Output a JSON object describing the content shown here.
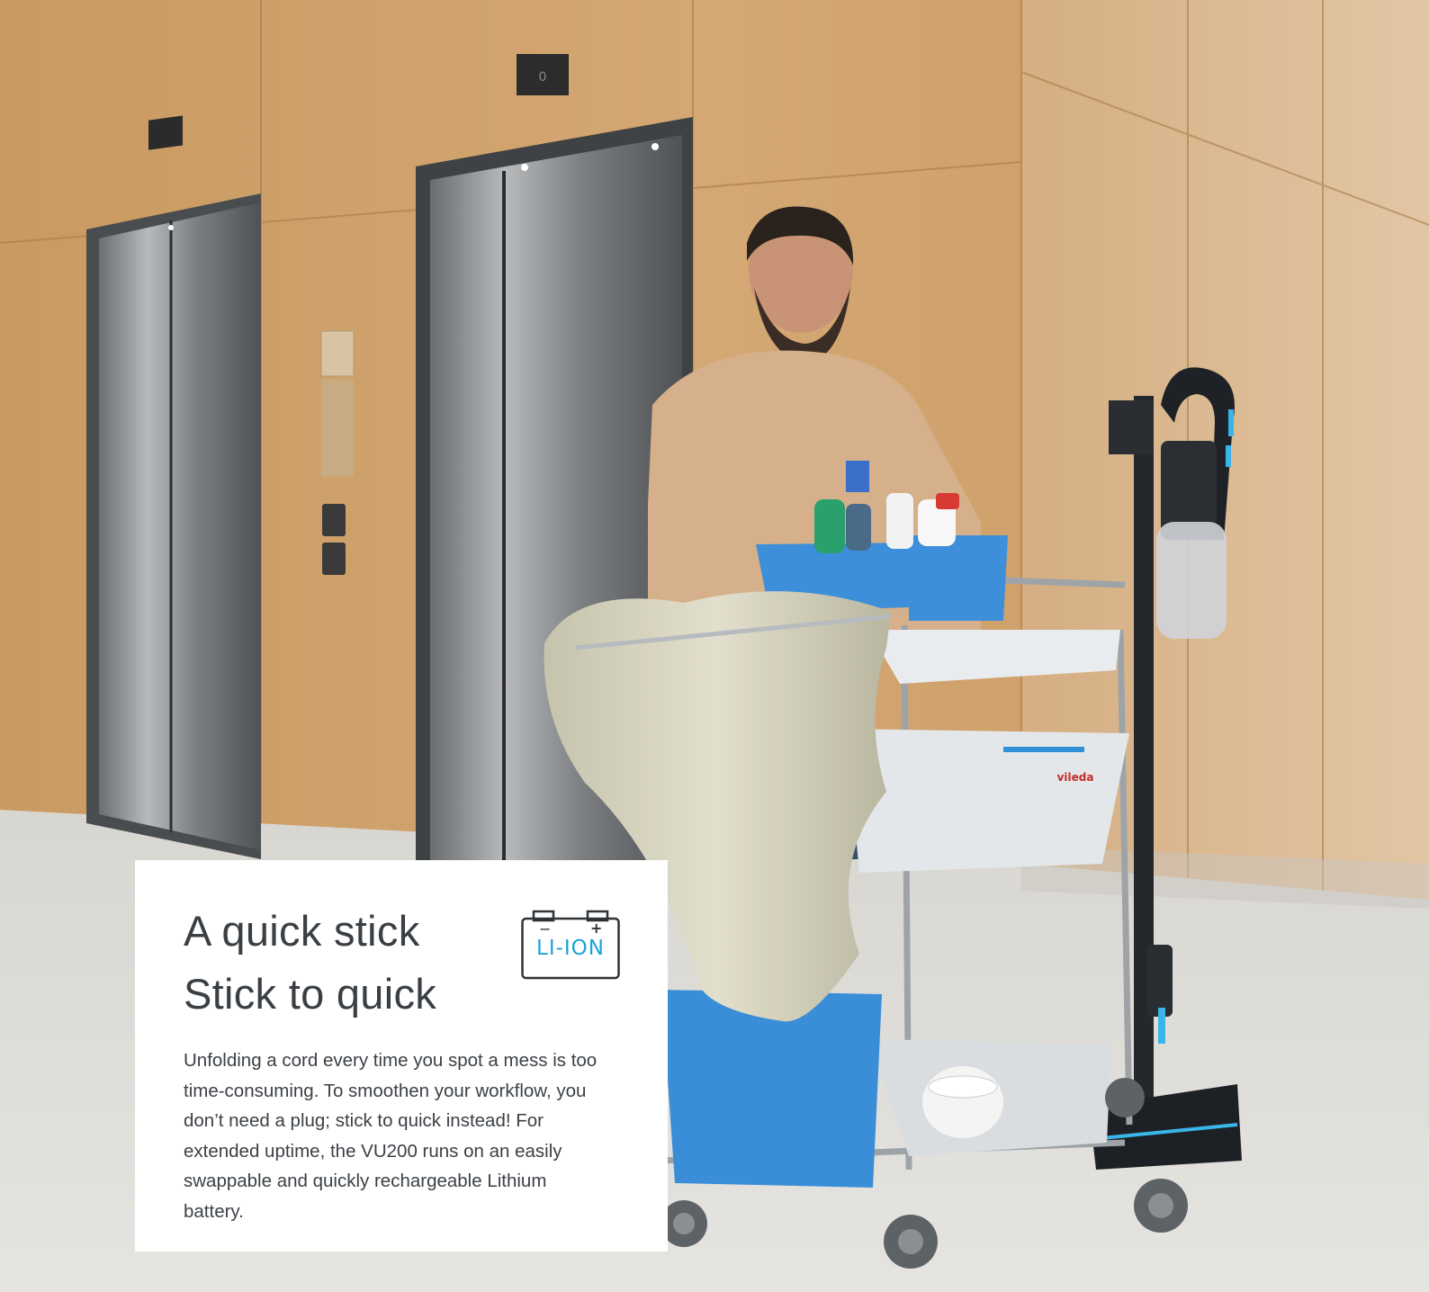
{
  "hero": {
    "scene": "office-corridor-with-cleaning-trolley",
    "colors": {
      "wood": "#c89a62",
      "floor": "#dcdad4",
      "steel": "#8a8d90",
      "accent": "#2f9bd8"
    }
  },
  "card": {
    "title_line1": "A quick stick",
    "title_line2": "Stick to quick",
    "body": "Unfolding a cord every time you spot a mess is too time-consuming. To smoothen your workflow, you don’t need a plug; stick to quick instead! For extended uptime, the VU200 runs on an easily swappable and quickly rechargeable Lithium battery.",
    "badge": {
      "icon": "battery-icon",
      "label": "LI-ION",
      "minus": "−",
      "plus": "+",
      "color": "#1aa3d8"
    }
  }
}
